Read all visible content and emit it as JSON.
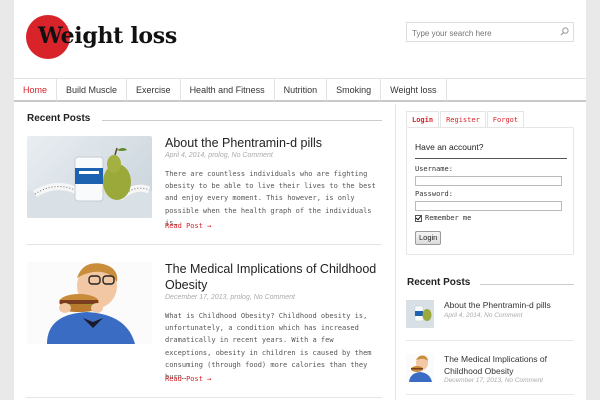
{
  "site": {
    "logo_text": "Weight loss",
    "brand_color": "#d8232a"
  },
  "search": {
    "placeholder": "Type your search here",
    "icon": "search-icon"
  },
  "nav": {
    "items": [
      {
        "label": "Home",
        "active": true
      },
      {
        "label": "Build Muscle",
        "active": false
      },
      {
        "label": "Exercise",
        "active": false
      },
      {
        "label": "Health and Fitness",
        "active": false
      },
      {
        "label": "Nutrition",
        "active": false
      },
      {
        "label": "Smoking",
        "active": false
      },
      {
        "label": "Weight loss",
        "active": false
      }
    ]
  },
  "main": {
    "section_title": "Recent Posts",
    "posts": [
      {
        "title": "About the Phentramin-d pills",
        "meta": "April 4, 2014, prolog, No Comment",
        "excerpt": "There are countless individuals who are fighting obesity to be able to live their lives to the best and enjoy every moment. This however, is only possible when the health graph of the individuals is…",
        "read_more": "Read Post →"
      },
      {
        "title": "The Medical Implications of Childhood Obesity",
        "meta": "December 17, 2013, prolog, No Comment",
        "excerpt": "What is Childhood Obesity? Childhood obesity is, unfortunately, a condition which has increased dramatically in recent years. With a few exceptions, obesity in children is caused by them consuming (through food) more calories than they burn…",
        "read_more": "Read Post →"
      }
    ]
  },
  "sidebar": {
    "login_tabs": [
      "Login",
      "Register",
      "Forgot"
    ],
    "login": {
      "heading": "Have an account?",
      "username_label": "Username:",
      "password_label": "Password:",
      "remember_label": "Remember me",
      "remember_checked": true,
      "button_label": "Login"
    },
    "recent_title": "Recent Posts",
    "recent_posts": [
      {
        "title": "About the Phentramin-d pills",
        "meta": "April 4, 2014, No Comment"
      },
      {
        "title": "The Medical Implications of Childhood Obesity",
        "meta": "December 17, 2013, No Comment"
      }
    ]
  }
}
